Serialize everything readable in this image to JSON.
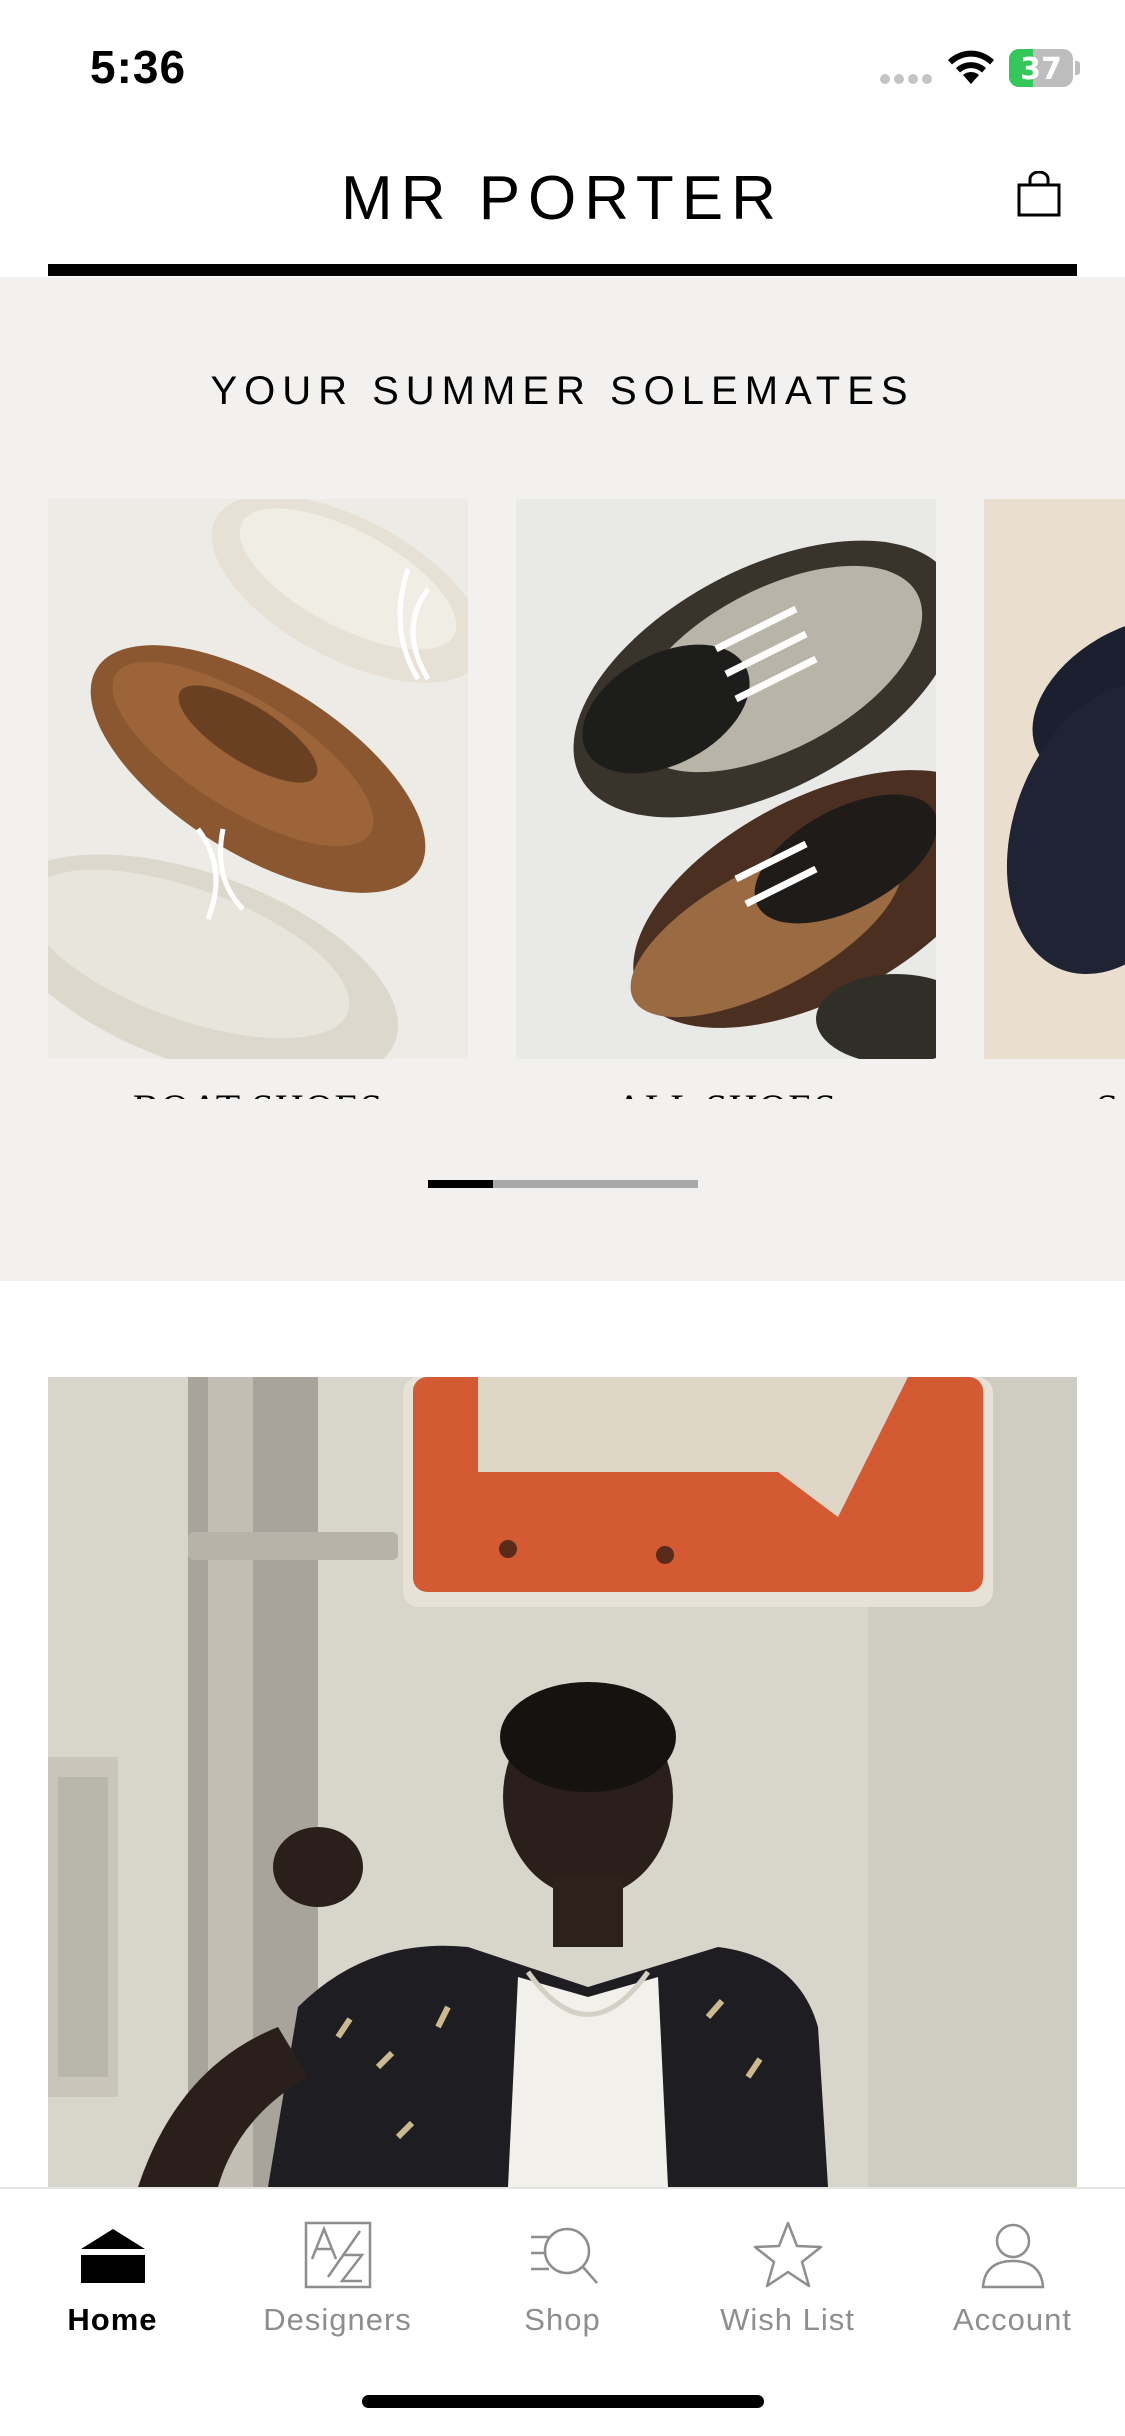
{
  "status_bar": {
    "time": "5:36",
    "battery_level": "37",
    "battery_fraction": 0.37,
    "battery_color": "#34c759"
  },
  "header": {
    "brand": "MR PORTER",
    "bag_icon": "shopping-bag-icon"
  },
  "carousel": {
    "title": "YOUR SUMMER SOLEMATES",
    "cards": [
      {
        "label": "BOAT SHOES",
        "image": "boat-shoes-photo"
      },
      {
        "label": "ALL SHOES",
        "image": "sneakers-photo"
      },
      {
        "label": "SA",
        "image": "sandals-photo"
      }
    ],
    "pager_position": 0.0,
    "pager_fraction": 0.24
  },
  "hero": {
    "image": "man-beside-street-sign-photo"
  },
  "tab_bar": {
    "items": [
      {
        "label": "Home",
        "icon": "home-icon",
        "active": true
      },
      {
        "label": "Designers",
        "icon": "a-z-icon",
        "active": false
      },
      {
        "label": "Shop",
        "icon": "search-list-icon",
        "active": false
      },
      {
        "label": "Wish List",
        "icon": "star-icon",
        "active": false
      },
      {
        "label": "Account",
        "icon": "person-icon",
        "active": false
      }
    ]
  },
  "colors": {
    "section_bg": "#f2f1ef",
    "active_tab": "#000000",
    "inactive_tab": "#8e8e8e"
  }
}
